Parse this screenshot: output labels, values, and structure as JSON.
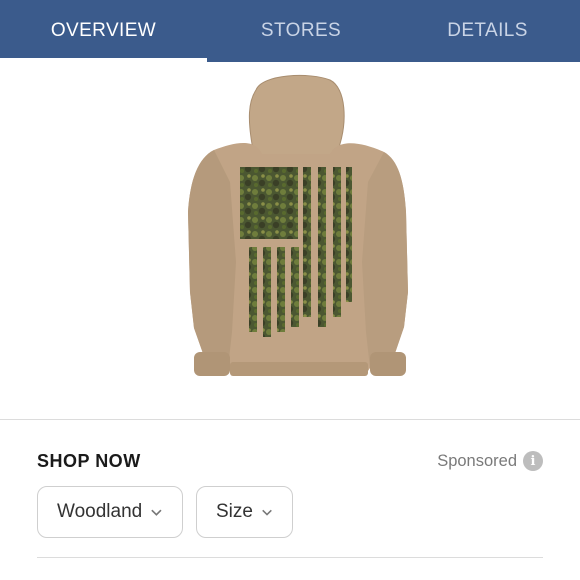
{
  "tabs": [
    {
      "label": "OVERVIEW",
      "active": true
    },
    {
      "label": "STORES",
      "active": false
    },
    {
      "label": "DETAILS",
      "active": false
    }
  ],
  "colors": {
    "tab_bar": "#3b5b8c",
    "hoodie": "#bfa486",
    "flag_camo": "#4d5a32"
  },
  "product": {
    "image_icon": "hoodie-camo-flag-image"
  },
  "shop": {
    "title": "SHOP NOW",
    "sponsored_label": "Sponsored",
    "info_icon": "info-icon"
  },
  "selectors": {
    "color_value": "Woodland",
    "size_value": "Size",
    "chevron_icon": "chevron-down-icon"
  }
}
